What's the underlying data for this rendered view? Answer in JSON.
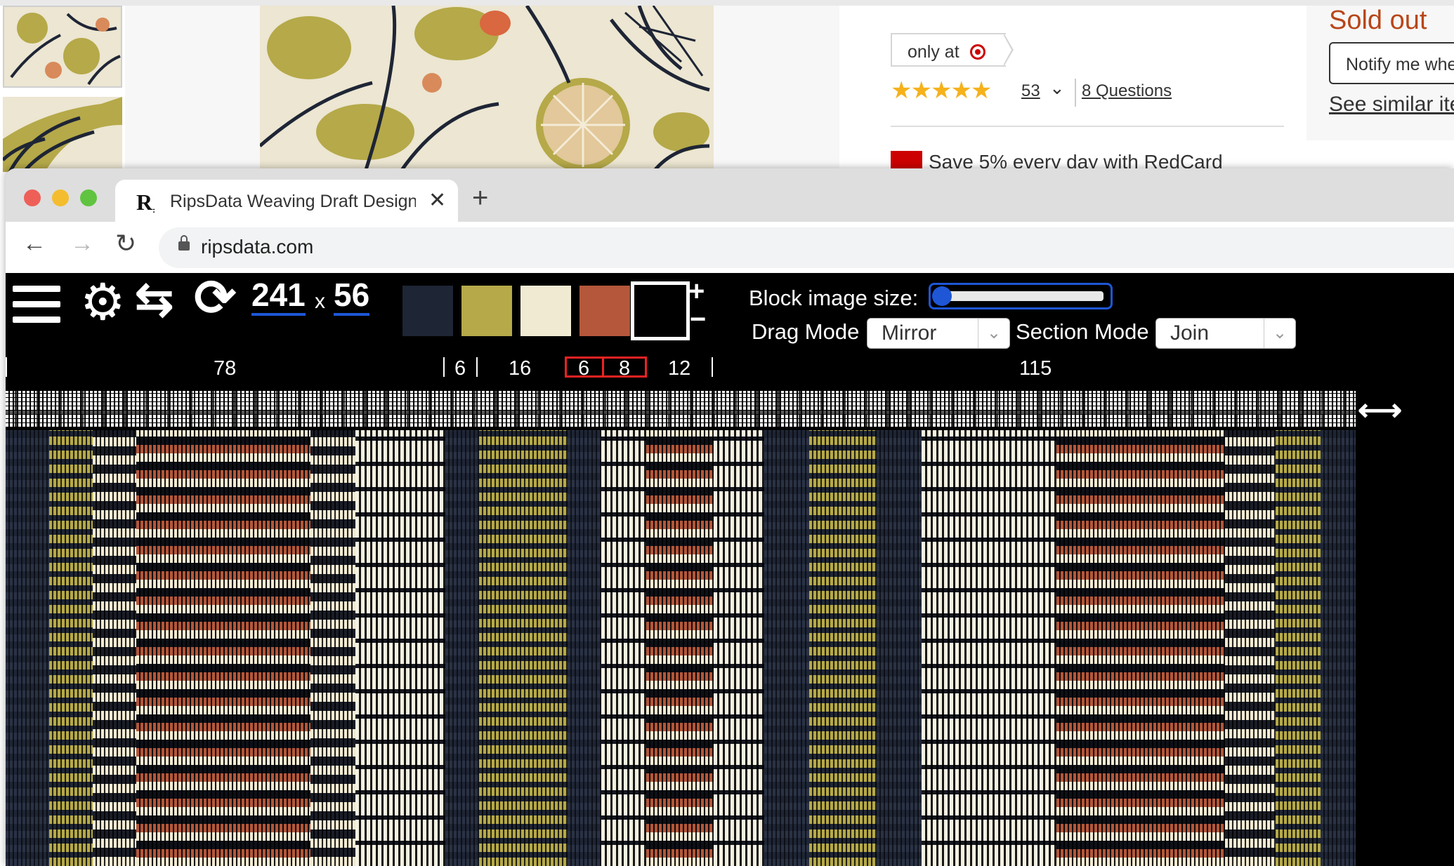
{
  "background_page": {
    "only_at_label": "only at",
    "rating_stars": "★★★★★",
    "rating_value": 5,
    "rating_count": "53",
    "questions_link": "8 Questions",
    "redcard_promo": "Save 5% every day with RedCard",
    "sold_out_label": "Sold out",
    "notify_button": "Notify me when",
    "see_similar_link": "See similar items",
    "icons": [
      "target-logo-icon",
      "chevron-down-icon",
      "redcard-icon"
    ]
  },
  "browser": {
    "tab_title": "RipsData Weaving Draft Designer",
    "url": "ripsdata.com",
    "icons": [
      "favicon-icon",
      "close-icon",
      "plus-icon",
      "back-arrow-icon",
      "forward-arrow-icon",
      "reload-icon",
      "lock-icon"
    ]
  },
  "app": {
    "toolbar": {
      "icons": [
        "menu-icon",
        "gear-icon",
        "swap-icon",
        "refresh-icon",
        "plus-icon",
        "minus-icon"
      ],
      "width_value": "241",
      "times_label": "x",
      "height_value": "56",
      "palette": [
        "#1e2535",
        "#b5a949",
        "#f1ead3",
        "#b4573a",
        "#000000"
      ],
      "selected_palette_index": 4,
      "block_image_size_label": "Block image size:",
      "block_image_size_level": 0.0,
      "drag_mode_label": "Drag Mode",
      "drag_mode_value": "Mirror",
      "section_mode_label": "Section Mode",
      "section_mode_value": "Join"
    },
    "sections": [
      "78",
      "6",
      "16",
      "6",
      "8",
      "12",
      "115"
    ],
    "highlighted_sections": [
      3,
      4
    ]
  }
}
